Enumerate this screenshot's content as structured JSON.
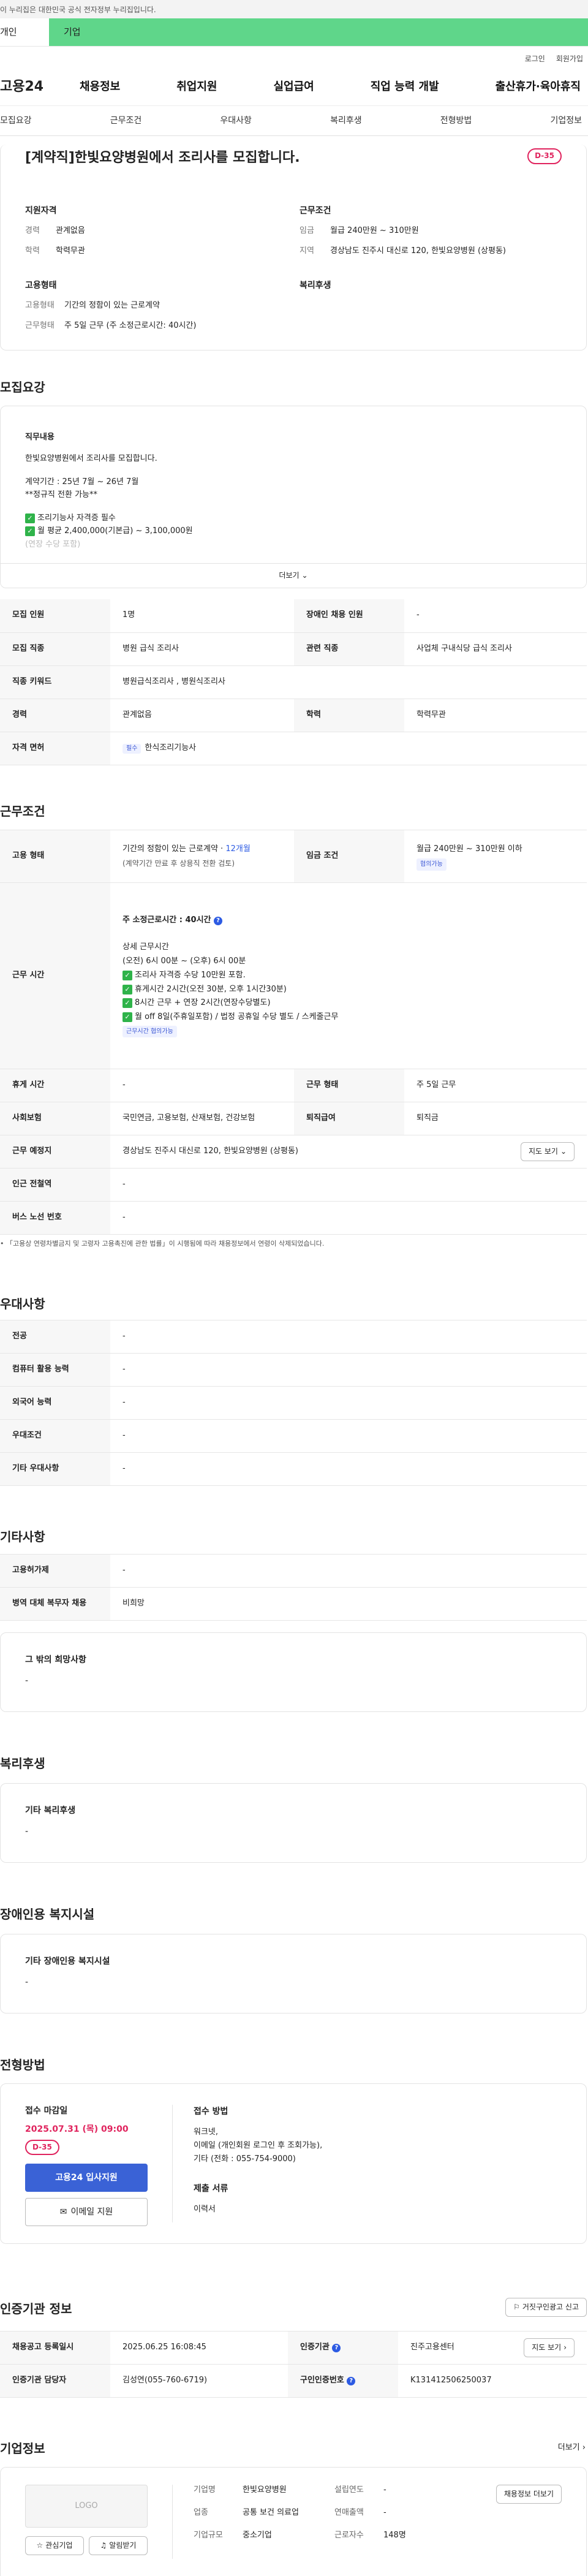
{
  "gov_banner": "이 누리집은 대한민국 공식 전자정부 누리집입니다.",
  "top_tabs": [
    "개인",
    "기업"
  ],
  "util": {
    "login": "로그인",
    "signup": "회원가입"
  },
  "logo": "고용24",
  "gnb": [
    "채용정보",
    "취업지원",
    "실업급여",
    "직업 능력 개발",
    "출산휴가·육아휴직"
  ],
  "subnav": [
    "모집요강",
    "근무조건",
    "우대사항",
    "복리후생",
    "전형방법",
    "기업정보"
  ],
  "job": {
    "title": "[계약직]한빛요양병원에서 조리사를 모집합니다.",
    "dday": "D-35"
  },
  "summary": {
    "qual_h": "지원자격",
    "career_k": "경력",
    "career_v": "관계없음",
    "edu_k": "학력",
    "edu_v": "학력무관",
    "cond_h": "근무조건",
    "wage_k": "임금",
    "wage_v": "월급 240만원 ~ 310만원",
    "area_k": "지역",
    "area_v": "경상남도 진주시 대신로 120, 한빛요양병원 (상평동)",
    "emp_h": "고용형태",
    "emptype_k": "고용형태",
    "emptype_v": "기간의 정함이 있는 근로계약",
    "worktype_k": "근무형태",
    "worktype_v": "주 5일 근무 (주 소정근로시간: 40시간)",
    "welfare_h": "복리후생"
  },
  "recruit": {
    "heading": "모집요강",
    "content_h": "직무내용",
    "line1": "한빛요양병원에서 조리사를 모집합니다.",
    "line2": "계약기간 : 25년 7월 ~ 26년 7월",
    "line3": "**정규직 전환 가능**",
    "line4": "조리기능사 자격증 필수",
    "line5": "월 평균 2,400,000(기본급) ~ 3,100,000원",
    "line6": "(연장 수당 포함)",
    "more": "더보기",
    "rows": [
      {
        "k": "모집 인원",
        "v": "1명",
        "k2": "장애인 채용 인원",
        "v2": "-"
      },
      {
        "k": "모집 직종",
        "v": "병원 급식 조리사",
        "k2": "관련 직종",
        "v2": "사업체 구내식당 급식 조리사"
      },
      {
        "k": "직종 키워드",
        "v": "병원급식조리사 , 병원식조리사"
      },
      {
        "k": "경력",
        "v": "관계없음",
        "k2": "학력",
        "v2": "학력무관"
      },
      {
        "k": "자격 면허",
        "chip": "필수",
        "v": "한식조리기능사"
      }
    ]
  },
  "cond": {
    "heading": "근무조건",
    "emptype_k": "고용 형태",
    "emptype_v1": "기간의 정함이 있는 근로계약 · ",
    "emptype_v1b": "12개월",
    "emptype_v2": "(계약기간 만료 후 상용직 전환 검토)",
    "wage_k": "임금 조건",
    "wage_v": "월급 240만원 ~ 310만원 이하",
    "wage_chip": "협의가능",
    "hours_k": "근무 시간",
    "hours_total": "주 소정근로시간 : 40시간",
    "hours_detail_h": "상세 근무시간",
    "hours_lines": [
      "(오전) 6시 00분 ~ (오후) 6시 00분",
      "조리사 자격증 수당 10만원 포함.",
      "휴게시간 2시간(오전 30분, 오후 1시간30분)",
      "8시간 근무 + 연장 2시간(연장수당별도)",
      "월 off 8일(주휴일포함) / 법정 공휴일 수당 별도 / 스케줄근무"
    ],
    "hours_chip": "근무시간 협의가능",
    "rest_k": "휴게 시간",
    "rest_v": "-",
    "shift_k": "근무 형태",
    "shift_v": "주 5일 근무",
    "ins_k": "사회보험",
    "ins_v": "국민연금, 고용보험, 산재보험, 건강보험",
    "retire_k": "퇴직급여",
    "retire_v": "퇴직금",
    "place_k": "근무 예정지",
    "place_v": "경상남도 진주시 대신로 120, 한빛요양병원 (상평동)",
    "map_btn": "지도 보기",
    "subway_k": "인근 전철역",
    "subway_v": "-",
    "bus_k": "버스 노선 번호",
    "bus_v": "-",
    "note": "「고용상 연령차별금지 및 고령자 고용촉진에 관한 법률」이 시행됨에 따라 채용정보에서 연령이 삭제되었습니다."
  },
  "pref": {
    "heading": "우대사항",
    "rows": [
      [
        "전공",
        "-"
      ],
      [
        "컴퓨터 활용 능력",
        "-"
      ],
      [
        "외국어 능력",
        "-"
      ],
      [
        "우대조건",
        "-"
      ],
      [
        "기타 우대사항",
        "-"
      ]
    ]
  },
  "etc": {
    "heading": "기타사항",
    "rows": [
      [
        "고용허가제",
        "-"
      ],
      [
        "병역 대체 복무자 채용",
        "비희망"
      ]
    ],
    "other_h": "그 밖의 희망사항",
    "other_v": "-"
  },
  "welfare": {
    "heading": "복리후생",
    "box_h": "기타 복리후생",
    "box_v": "-"
  },
  "disab": {
    "heading": "장애인용 복지시설",
    "box_h": "기타 장애인용 복지시설",
    "box_v": "-"
  },
  "apply": {
    "heading": "전형방법",
    "deadline_h": "접수 마감일",
    "deadline": "2025.07.31 (목) 09:00",
    "dday": "D-35",
    "apply_btn": "고용24 입사지원",
    "email_btn": "이메일 지원",
    "method_h": "접수 방법",
    "method_lines": [
      "워크넷,",
      "이메일 (개인회원 로그인 후 조회가능),",
      "기타 (전화 : 055-754-9000)"
    ],
    "docs_h": "제출 서류",
    "docs_v": "이력서"
  },
  "auth": {
    "heading": "인증기관 정보",
    "report_btn": "거짓구인광고 신고",
    "reg_k": "채용공고 등록일시",
    "reg_v": "2025.06.25 16:08:45",
    "org_k": "인증기관",
    "org_v": "진주고용센터",
    "map_btn": "지도 보기",
    "manager_k": "인증기관 담당자",
    "manager_v": "김성연(055-760-6719)",
    "no_k": "구인인증번호",
    "no_v": "K131412506250037"
  },
  "company": {
    "heading": "기업정보",
    "more": "더보기",
    "logo": "LOGO",
    "fav_btn": "관심기업",
    "notice_btn": "알림받기",
    "name_k": "기업명",
    "name_v": "한빛요양병원",
    "year_k": "설립연도",
    "year_v": "-",
    "ind_k": "업종",
    "ind_v": "공통 보건 의료업",
    "sales_k": "연매출액",
    "sales_v": "-",
    "size_k": "기업규모",
    "size_v": "중소기업",
    "staff_k": "근로자수",
    "staff_v": "148명",
    "jobs_btn": "채용정보 더보기"
  }
}
